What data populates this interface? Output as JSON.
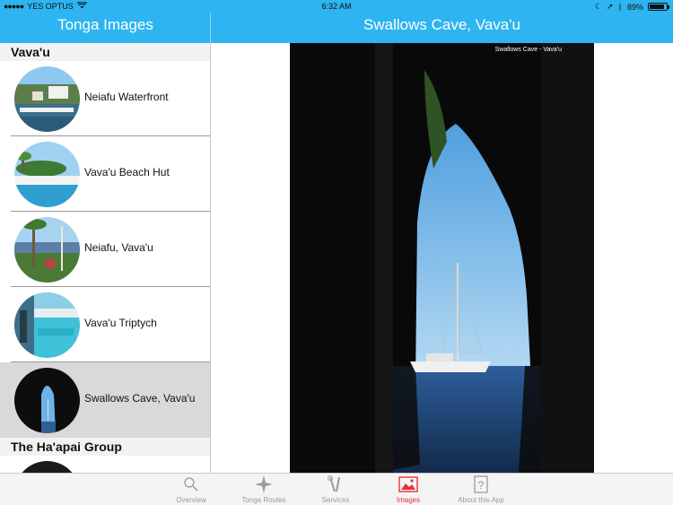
{
  "status_bar": {
    "carrier": "YES OPTUS",
    "time": "6:32 AM",
    "battery": "89%",
    "battery_level": 0.89
  },
  "master": {
    "title": "Tonga Images",
    "sections": [
      {
        "title": "Vava'u",
        "items": [
          {
            "label": "Neiafu Waterfront"
          },
          {
            "label": "Vava'u Beach Hut"
          },
          {
            "label": "Neiafu, Vava'u"
          },
          {
            "label": "Vava'u Triptych"
          },
          {
            "label": "Swallows Cave, Vava'u",
            "selected": true
          }
        ]
      },
      {
        "title": "The Ha'apai Group",
        "items": []
      }
    ]
  },
  "detail": {
    "title": "Swallows Cave, Vava'u",
    "image_caption": "Swallows Cave - Vava'u"
  },
  "tabbar": {
    "items": [
      {
        "label": "Overview",
        "icon": "magnifier-icon"
      },
      {
        "label": "Tonga Routes",
        "icon": "compass-rose-icon"
      },
      {
        "label": "Services",
        "icon": "tools-icon"
      },
      {
        "label": "Images",
        "icon": "image-icon",
        "active": true
      },
      {
        "label": "About this App",
        "icon": "question-icon"
      }
    ],
    "active_color": "#e8323c"
  },
  "colors": {
    "header_blue": "#2eb4f0",
    "selected_row": "#d9d9d9"
  }
}
